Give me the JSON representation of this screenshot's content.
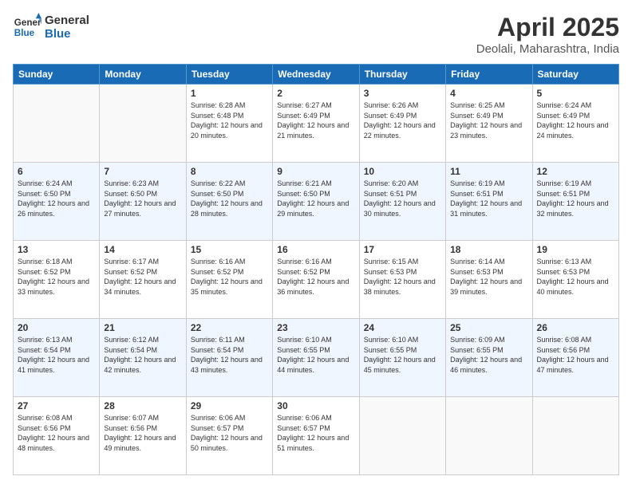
{
  "header": {
    "logo_line1": "General",
    "logo_line2": "Blue",
    "title": "April 2025",
    "subtitle": "Deolali, Maharashtra, India"
  },
  "days_of_week": [
    "Sunday",
    "Monday",
    "Tuesday",
    "Wednesday",
    "Thursday",
    "Friday",
    "Saturday"
  ],
  "weeks": [
    [
      {
        "day": null
      },
      {
        "day": null
      },
      {
        "day": "1",
        "sunrise": "6:28 AM",
        "sunset": "6:48 PM",
        "daylight": "12 hours and 20 minutes."
      },
      {
        "day": "2",
        "sunrise": "6:27 AM",
        "sunset": "6:49 PM",
        "daylight": "12 hours and 21 minutes."
      },
      {
        "day": "3",
        "sunrise": "6:26 AM",
        "sunset": "6:49 PM",
        "daylight": "12 hours and 22 minutes."
      },
      {
        "day": "4",
        "sunrise": "6:25 AM",
        "sunset": "6:49 PM",
        "daylight": "12 hours and 23 minutes."
      },
      {
        "day": "5",
        "sunrise": "6:24 AM",
        "sunset": "6:49 PM",
        "daylight": "12 hours and 24 minutes."
      }
    ],
    [
      {
        "day": "6",
        "sunrise": "6:24 AM",
        "sunset": "6:50 PM",
        "daylight": "12 hours and 26 minutes."
      },
      {
        "day": "7",
        "sunrise": "6:23 AM",
        "sunset": "6:50 PM",
        "daylight": "12 hours and 27 minutes."
      },
      {
        "day": "8",
        "sunrise": "6:22 AM",
        "sunset": "6:50 PM",
        "daylight": "12 hours and 28 minutes."
      },
      {
        "day": "9",
        "sunrise": "6:21 AM",
        "sunset": "6:50 PM",
        "daylight": "12 hours and 29 minutes."
      },
      {
        "day": "10",
        "sunrise": "6:20 AM",
        "sunset": "6:51 PM",
        "daylight": "12 hours and 30 minutes."
      },
      {
        "day": "11",
        "sunrise": "6:19 AM",
        "sunset": "6:51 PM",
        "daylight": "12 hours and 31 minutes."
      },
      {
        "day": "12",
        "sunrise": "6:19 AM",
        "sunset": "6:51 PM",
        "daylight": "12 hours and 32 minutes."
      }
    ],
    [
      {
        "day": "13",
        "sunrise": "6:18 AM",
        "sunset": "6:52 PM",
        "daylight": "12 hours and 33 minutes."
      },
      {
        "day": "14",
        "sunrise": "6:17 AM",
        "sunset": "6:52 PM",
        "daylight": "12 hours and 34 minutes."
      },
      {
        "day": "15",
        "sunrise": "6:16 AM",
        "sunset": "6:52 PM",
        "daylight": "12 hours and 35 minutes."
      },
      {
        "day": "16",
        "sunrise": "6:16 AM",
        "sunset": "6:52 PM",
        "daylight": "12 hours and 36 minutes."
      },
      {
        "day": "17",
        "sunrise": "6:15 AM",
        "sunset": "6:53 PM",
        "daylight": "12 hours and 38 minutes."
      },
      {
        "day": "18",
        "sunrise": "6:14 AM",
        "sunset": "6:53 PM",
        "daylight": "12 hours and 39 minutes."
      },
      {
        "day": "19",
        "sunrise": "6:13 AM",
        "sunset": "6:53 PM",
        "daylight": "12 hours and 40 minutes."
      }
    ],
    [
      {
        "day": "20",
        "sunrise": "6:13 AM",
        "sunset": "6:54 PM",
        "daylight": "12 hours and 41 minutes."
      },
      {
        "day": "21",
        "sunrise": "6:12 AM",
        "sunset": "6:54 PM",
        "daylight": "12 hours and 42 minutes."
      },
      {
        "day": "22",
        "sunrise": "6:11 AM",
        "sunset": "6:54 PM",
        "daylight": "12 hours and 43 minutes."
      },
      {
        "day": "23",
        "sunrise": "6:10 AM",
        "sunset": "6:55 PM",
        "daylight": "12 hours and 44 minutes."
      },
      {
        "day": "24",
        "sunrise": "6:10 AM",
        "sunset": "6:55 PM",
        "daylight": "12 hours and 45 minutes."
      },
      {
        "day": "25",
        "sunrise": "6:09 AM",
        "sunset": "6:55 PM",
        "daylight": "12 hours and 46 minutes."
      },
      {
        "day": "26",
        "sunrise": "6:08 AM",
        "sunset": "6:56 PM",
        "daylight": "12 hours and 47 minutes."
      }
    ],
    [
      {
        "day": "27",
        "sunrise": "6:08 AM",
        "sunset": "6:56 PM",
        "daylight": "12 hours and 48 minutes."
      },
      {
        "day": "28",
        "sunrise": "6:07 AM",
        "sunset": "6:56 PM",
        "daylight": "12 hours and 49 minutes."
      },
      {
        "day": "29",
        "sunrise": "6:06 AM",
        "sunset": "6:57 PM",
        "daylight": "12 hours and 50 minutes."
      },
      {
        "day": "30",
        "sunrise": "6:06 AM",
        "sunset": "6:57 PM",
        "daylight": "12 hours and 51 minutes."
      },
      {
        "day": null
      },
      {
        "day": null
      },
      {
        "day": null
      }
    ]
  ],
  "labels": {
    "sunrise_prefix": "Sunrise: ",
    "sunset_prefix": "Sunset: ",
    "daylight_prefix": "Daylight: "
  }
}
